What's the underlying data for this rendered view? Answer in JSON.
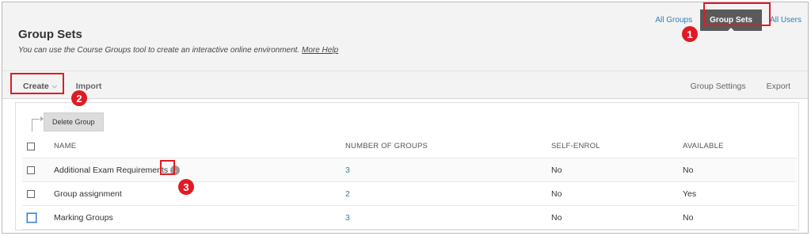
{
  "topnav": {
    "all_groups": "All Groups",
    "group_sets": "Group Sets",
    "all_users": "All Users"
  },
  "header": {
    "title": "Group Sets",
    "description": "You can use the Course Groups tool to create an interactive online environment.",
    "help_link": "More Help"
  },
  "actions": {
    "create": "Create",
    "import": "Import",
    "group_settings": "Group Settings",
    "export": "Export"
  },
  "toolbar": {
    "delete_group": "Delete Group"
  },
  "table": {
    "columns": [
      "NAME",
      "NUMBER OF GROUPS",
      "SELF-ENROL",
      "AVAILABLE"
    ],
    "rows": [
      {
        "name": "Additional Exam Requirements",
        "groups": "3",
        "self_enrol": "No",
        "available": "No"
      },
      {
        "name": "Group assignment",
        "groups": "2",
        "self_enrol": "No",
        "available": "Yes"
      },
      {
        "name": "Marking Groups",
        "groups": "3",
        "self_enrol": "No",
        "available": "No"
      }
    ]
  },
  "callouts": [
    "1",
    "2",
    "3"
  ],
  "colors": {
    "accent_link": "#2d7fb8",
    "annotation_red": "#e01b24",
    "active_tab": "#5a5a5a"
  },
  "icons": {
    "row_menu": "chevron-down-icon",
    "create_dropdown": "chevron-down-icon",
    "elbow": "elbow-arrow-icon"
  }
}
